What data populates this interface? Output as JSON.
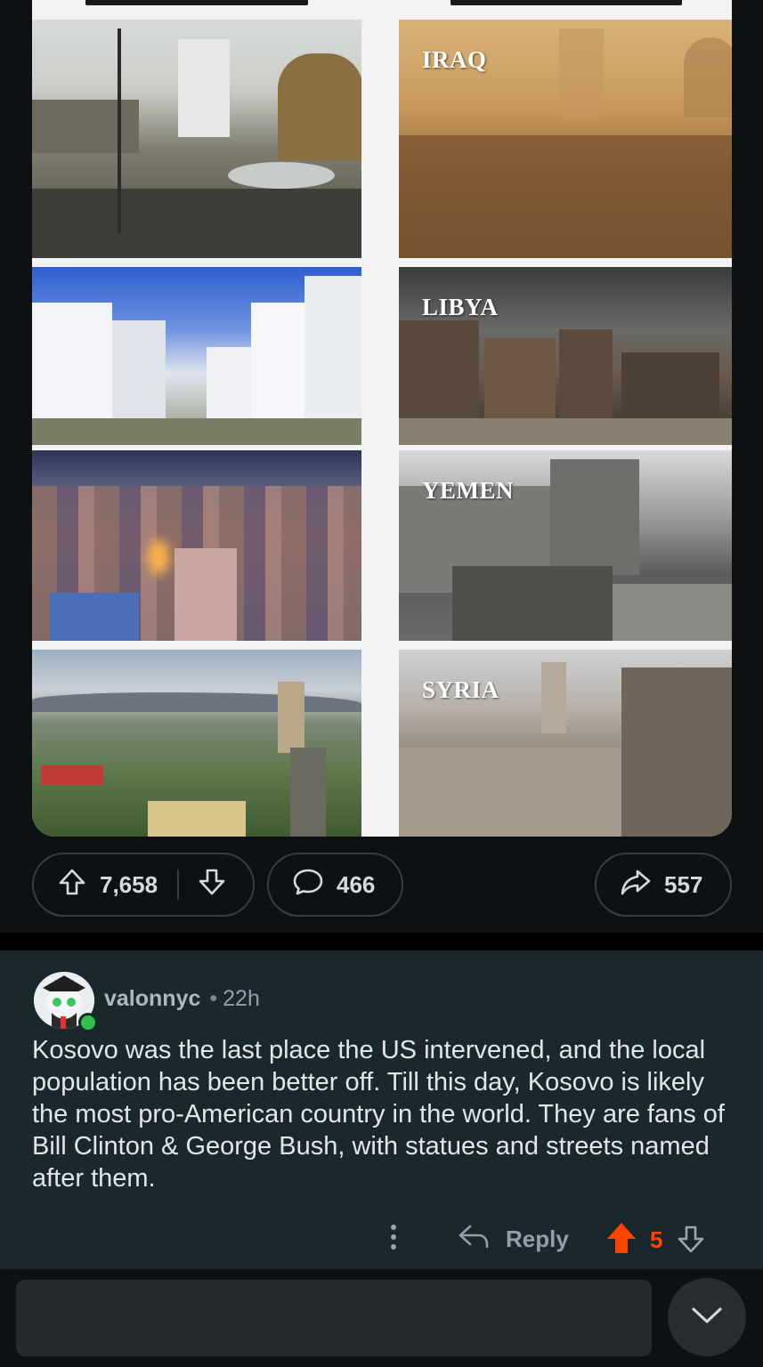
{
  "post": {
    "image": {
      "panels": [
        {
          "row": 1,
          "side": "before",
          "label": ""
        },
        {
          "row": 1,
          "side": "after",
          "label": "IRAQ"
        },
        {
          "row": 2,
          "side": "before",
          "label": ""
        },
        {
          "row": 2,
          "side": "after",
          "label": "LIBYA"
        },
        {
          "row": 3,
          "side": "before",
          "label": ""
        },
        {
          "row": 3,
          "side": "after",
          "label": "YEMEN"
        },
        {
          "row": 4,
          "side": "before",
          "label": ""
        },
        {
          "row": 4,
          "side": "after",
          "label": "SYRIA"
        }
      ]
    },
    "actions": {
      "upvote_count": "7,658",
      "comment_count": "466",
      "share_count": "557"
    }
  },
  "comment": {
    "username": "valonnyc",
    "separator": "•",
    "age": "22h",
    "body": "Kosovo was the last place the US intervened, and the local population has been better off. Till this day, Kosovo is likely the most pro-American country in the world. They are fans of Bill Clinton & George Bush, with statues and streets named after them.",
    "reply_label": "Reply",
    "score": "5",
    "colors": {
      "upvoted": "#ff4500",
      "online": "#2fbf4a"
    }
  },
  "bottom_bar": {
    "reply_placeholder": ""
  },
  "icons": [
    "upvote-icon",
    "downvote-icon",
    "comment-icon",
    "share-icon",
    "more-icon",
    "reply-icon",
    "chevron-down-icon"
  ]
}
